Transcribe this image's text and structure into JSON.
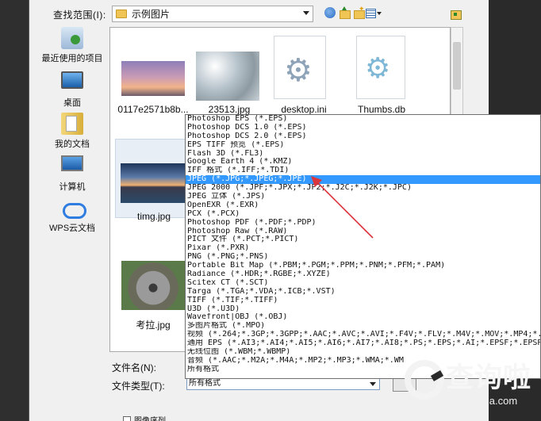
{
  "toolbar": {
    "look_in_label": "查找范围(I):",
    "look_in_value": "示例图片"
  },
  "places": [
    {
      "label": "最近使用的项目",
      "icon": "recent-items-icon"
    },
    {
      "label": "桌面",
      "icon": "desktop-icon"
    },
    {
      "label": "我的文档",
      "icon": "documents-icon"
    },
    {
      "label": "计算机",
      "icon": "computer-icon"
    },
    {
      "label": "WPS云文档",
      "icon": "cloud-icon"
    }
  ],
  "files": [
    {
      "name": "0117e2571b8b...",
      "kind": "image"
    },
    {
      "name": "23513.jpg",
      "kind": "image"
    },
    {
      "name": "desktop.ini",
      "kind": "settings-file"
    },
    {
      "name": "Thumbs.db",
      "kind": "settings-file"
    },
    {
      "name": "timg.jpg",
      "kind": "image"
    },
    {
      "name": "考拉.jpg",
      "kind": "image"
    }
  ],
  "footer": {
    "filename_label": "文件名(N):",
    "filetype_label": "文件类型(T):",
    "filetype_value": "所有格式",
    "sequence_label": "图像序列"
  },
  "dropdown": {
    "highlighted_index": 7,
    "items": [
      "Photoshop EPS (*.EPS)",
      "Photoshop DCS 1.0 (*.EPS)",
      "Photoshop DCS 2.0 (*.EPS)",
      "EPS TIFF 预览 (*.EPS)",
      "Flash 3D (*.FL3)",
      "Google Earth 4 (*.KMZ)",
      "IFF 格式 (*.IFF;*.TDI)",
      "JPEG (*.JPG;*.JPEG;*.JPE)",
      "JPEG 2000 (*.JPF;*.JPX;*.JP2;*.J2C;*.J2K;*.JPC)",
      "JPEG 立体 (*.JPS)",
      "OpenEXR (*.EXR)",
      "PCX (*.PCX)",
      "Photoshop PDF (*.PDF;*.PDP)",
      "Photoshop Raw (*.RAW)",
      "PICT 文件 (*.PCT;*.PICT)",
      "Pixar (*.PXR)",
      "PNG (*.PNG;*.PNS)",
      "Portable Bit Map (*.PBM;*.PGM;*.PPM;*.PNM;*.PFM;*.PAM)",
      "Radiance (*.HDR;*.RGBE;*.XYZE)",
      "Scitex CT (*.SCT)",
      "Targa (*.TGA;*.VDA;*.ICB;*.VST)",
      "TIFF (*.TIF;*.TIFF)",
      "U3D (*.U3D)",
      "Wavefront|OBJ (*.OBJ)",
      "多图片格式 (*.MPO)",
      "视频 (*.264;*.3GP;*.3GPP;*.AAC;*.AVC;*.AVI;*.F4V;*.FLV;*.M4V;*.MOV;*.MP4;*.MP",
      "通用 EPS (*.AI3;*.AI4;*.AI5;*.AI6;*.AI7;*.AI8;*.PS;*.EPS;*.AI;*.EPSF;*.EPSP)",
      "无线位图 (*.WBM;*.WBMP)",
      "音频 (*.AAC;*.M2A;*.M4A;*.MP2;*.MP3;*.WMA;*.WM",
      "所有格式"
    ]
  },
  "watermark": {
    "brand": "查询啦",
    "domain": "chaxunla.com"
  },
  "colors": {
    "highlight": "#3399ff",
    "annotation_arrow": "#d9363e",
    "dialog_bg": "#f0f0f0"
  }
}
